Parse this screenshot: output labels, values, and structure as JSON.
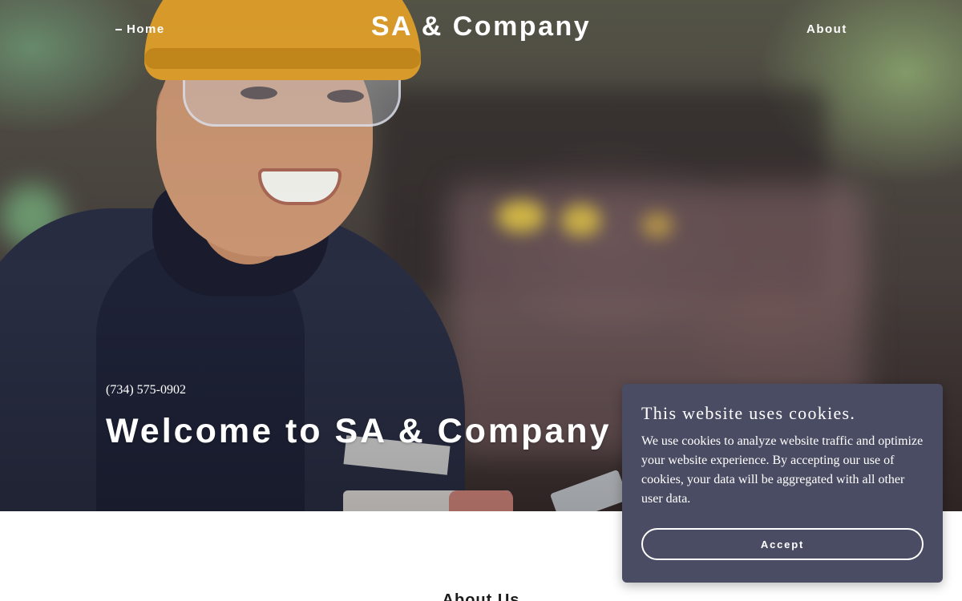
{
  "header": {
    "brand": "SA & Company",
    "nav": {
      "home_label": "Home",
      "about_label": "About"
    }
  },
  "hero": {
    "image_description_icon": "worker-photo",
    "phone": "(734) 575-0902",
    "title": "Welcome to SA & Company"
  },
  "section": {
    "about_heading": "About Us"
  },
  "cookie_banner": {
    "title": "This website uses cookies.",
    "body": "We use cookies to analyze website traffic and optimize your website experience. By accepting our use of cookies, your data will be aggregated with all other user data.",
    "accept_label": "Accept",
    "background_color": "#4a4c63"
  },
  "colors": {
    "text_on_hero": "#ffffff",
    "page_background": "#ffffff"
  }
}
